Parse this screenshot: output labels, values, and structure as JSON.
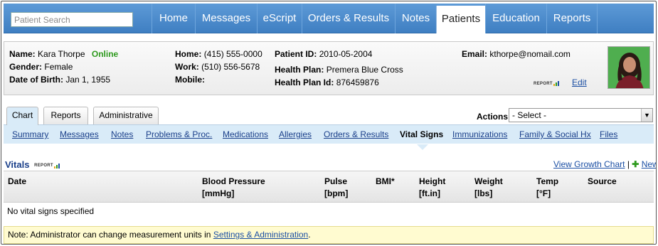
{
  "search": {
    "placeholder": "Patient Search"
  },
  "nav": {
    "items": [
      "Home",
      "Messages",
      "eScript",
      "Orders & Results",
      "Notes",
      "Patients",
      "Education",
      "Reports"
    ],
    "active": "Patients"
  },
  "patient": {
    "name_label": "Name:",
    "name": "Kara Thorpe",
    "status": "Online",
    "gender_label": "Gender:",
    "gender": "Female",
    "dob_label": "Date of Birth:",
    "dob": "Jan 1, 1955",
    "home_label": "Home:",
    "home": "(415) 555-0000",
    "work_label": "Work:",
    "work": "(510) 556-5678",
    "mobile_label": "Mobile:",
    "mobile": "",
    "pid_label": "Patient ID:",
    "pid": "2010-05-2004",
    "plan_label": "Health Plan:",
    "plan": "Premera Blue Cross",
    "planid_label": "Health Plan Id:",
    "planid": "876459876",
    "email_label": "Email:",
    "email": "kthorpe@nomail.com",
    "report_logo": "REPORT",
    "edit_label": "Edit"
  },
  "tabs": [
    "Chart",
    "Reports",
    "Administrative"
  ],
  "actions": {
    "label": "Actions",
    "selected": "- Select -"
  },
  "subnav": [
    "Summary",
    "Messages",
    "Notes",
    "Problems & Proc.",
    "Medications",
    "Allergies",
    "Orders & Results",
    "Vital Signs",
    "Immunizations",
    "Family & Social Hx",
    "Files"
  ],
  "vitals": {
    "title": "Vitals",
    "report_logo": "REPORT",
    "growth_chart": "View Growth Chart",
    "separator": "|",
    "new_label": "New",
    "columns": [
      {
        "l1": "Date",
        "l2": ""
      },
      {
        "l1": "Blood Pressure",
        "l2": "[mmHg]"
      },
      {
        "l1": "Pulse",
        "l2": "[bpm]"
      },
      {
        "l1": "BMI*",
        "l2": ""
      },
      {
        "l1": "Height",
        "l2": "[ft.in]"
      },
      {
        "l1": "Weight",
        "l2": "[lbs]"
      },
      {
        "l1": "Temp",
        "l2": "[°F]"
      },
      {
        "l1": "Source",
        "l2": ""
      }
    ],
    "empty": "No vital signs specified"
  },
  "note": {
    "text": "Note: Administrator can change measurement units in ",
    "link": "Settings & Administration",
    "suffix": "."
  },
  "colors": {
    "nav_blue": "#4a8bcd",
    "subnav": "#d9ebf8",
    "online": "#2e9a1e",
    "link": "#1a4ea3",
    "note_bg": "#fffbd0"
  }
}
